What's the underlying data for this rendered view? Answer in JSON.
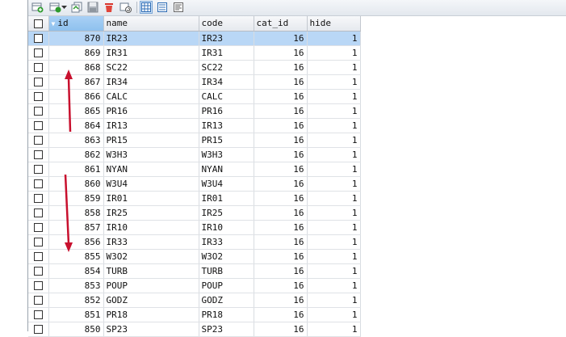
{
  "toolbar": {
    "icons": [
      "add-row-icon",
      "dropdown-arrow-icon",
      "duplicate-row-icon",
      "save-icon",
      "delete-icon",
      "refresh-icon",
      "grid-view-icon",
      "form-view-icon",
      "text-view-icon"
    ]
  },
  "columns": [
    {
      "key": "id",
      "label": "id",
      "align": "right",
      "sorted": true
    },
    {
      "key": "name",
      "label": "name",
      "align": "left"
    },
    {
      "key": "code",
      "label": "code",
      "align": "left"
    },
    {
      "key": "cat_id",
      "label": "cat_id",
      "align": "right"
    },
    {
      "key": "hide",
      "label": "hide",
      "align": "right"
    }
  ],
  "rows": [
    {
      "id": "870",
      "name": "IR23",
      "code": "IR23",
      "cat_id": "16",
      "hide": "1",
      "selected": true
    },
    {
      "id": "869",
      "name": "IR31",
      "code": "IR31",
      "cat_id": "16",
      "hide": "1"
    },
    {
      "id": "868",
      "name": "SC22",
      "code": "SC22",
      "cat_id": "16",
      "hide": "1"
    },
    {
      "id": "867",
      "name": "IR34",
      "code": "IR34",
      "cat_id": "16",
      "hide": "1"
    },
    {
      "id": "866",
      "name": "CALC",
      "code": "CALC",
      "cat_id": "16",
      "hide": "1"
    },
    {
      "id": "865",
      "name": "PR16",
      "code": "PR16",
      "cat_id": "16",
      "hide": "1"
    },
    {
      "id": "864",
      "name": "IR13",
      "code": "IR13",
      "cat_id": "16",
      "hide": "1"
    },
    {
      "id": "863",
      "name": "PR15",
      "code": "PR15",
      "cat_id": "16",
      "hide": "1"
    },
    {
      "id": "862",
      "name": "W3H3",
      "code": "W3H3",
      "cat_id": "16",
      "hide": "1"
    },
    {
      "id": "861",
      "name": "NYAN",
      "code": "NYAN",
      "cat_id": "16",
      "hide": "1"
    },
    {
      "id": "860",
      "name": "W3U4",
      "code": "W3U4",
      "cat_id": "16",
      "hide": "1"
    },
    {
      "id": "859",
      "name": "IR01",
      "code": "IR01",
      "cat_id": "16",
      "hide": "1"
    },
    {
      "id": "858",
      "name": "IR25",
      "code": "IR25",
      "cat_id": "16",
      "hide": "1"
    },
    {
      "id": "857",
      "name": "IR10",
      "code": "IR10",
      "cat_id": "16",
      "hide": "1"
    },
    {
      "id": "856",
      "name": "IR33",
      "code": "IR33",
      "cat_id": "16",
      "hide": "1"
    },
    {
      "id": "855",
      "name": "W3O2",
      "code": "W3O2",
      "cat_id": "16",
      "hide": "1"
    },
    {
      "id": "854",
      "name": "TURB",
      "code": "TURB",
      "cat_id": "16",
      "hide": "1"
    },
    {
      "id": "853",
      "name": "POUP",
      "code": "POUP",
      "cat_id": "16",
      "hide": "1"
    },
    {
      "id": "852",
      "name": "GODZ",
      "code": "GODZ",
      "cat_id": "16",
      "hide": "1"
    },
    {
      "id": "851",
      "name": "PR18",
      "code": "PR18",
      "cat_id": "16",
      "hide": "1"
    },
    {
      "id": "850",
      "name": "SP23",
      "code": "SP23",
      "cat_id": "16",
      "hide": "1"
    }
  ],
  "colors": {
    "selection": "#b9d7f6",
    "sorted_header": "#8ec1ee",
    "annotation_arrow": "#c8102e"
  }
}
